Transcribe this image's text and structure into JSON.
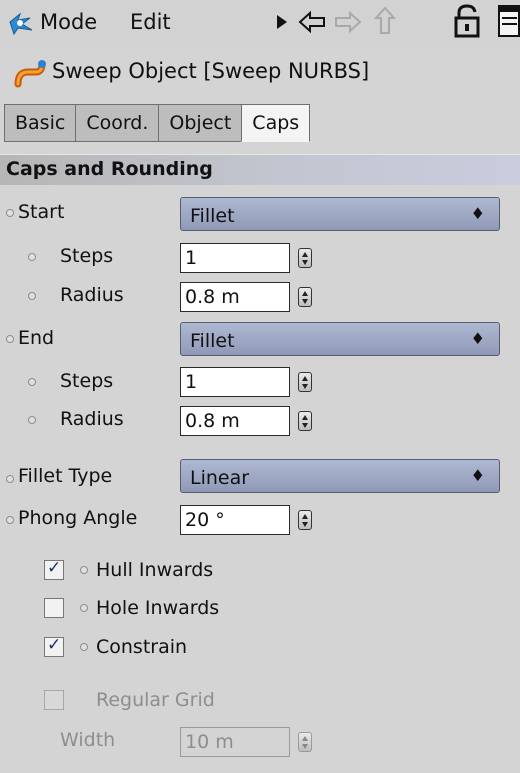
{
  "toolbar": {
    "mode_label": "Mode",
    "edit_label": "Edit"
  },
  "object": {
    "title": "Sweep Object [Sweep NURBS]"
  },
  "tabs": [
    {
      "label": "Basic",
      "active": false
    },
    {
      "label": "Coord.",
      "active": false
    },
    {
      "label": "Object",
      "active": false
    },
    {
      "label": "Caps",
      "active": true
    }
  ],
  "section": {
    "title": "Caps and Rounding"
  },
  "start": {
    "label": "Start",
    "value": "Fillet",
    "steps_label": "Steps",
    "steps_value": "1",
    "radius_label": "Radius",
    "radius_value": "0.8 m"
  },
  "end": {
    "label": "End",
    "value": "Fillet",
    "steps_label": "Steps",
    "steps_value": "1",
    "radius_label": "Radius",
    "radius_value": "0.8 m"
  },
  "fillet_type": {
    "label": "Fillet Type",
    "value": "Linear"
  },
  "phong": {
    "label": "Phong Angle",
    "value": "20 °"
  },
  "options": {
    "hull_inwards": {
      "label": "Hull Inwards",
      "checked": true
    },
    "hole_inwards": {
      "label": "Hole Inwards",
      "checked": false
    },
    "constrain": {
      "label": "Constrain",
      "checked": true
    },
    "regular_grid": {
      "label": "Regular Grid",
      "checked": false,
      "enabled": false
    }
  },
  "width": {
    "label": "Width",
    "value": "10 m"
  },
  "icons": {
    "mode": "mode-icon",
    "play": "play-arrow-icon",
    "back": "back-arrow-icon",
    "forward": "forward-arrow-icon",
    "up": "up-arrow-icon",
    "lock": "lock-icon",
    "window": "new-window-icon",
    "sweep": "sweep-object-icon"
  }
}
